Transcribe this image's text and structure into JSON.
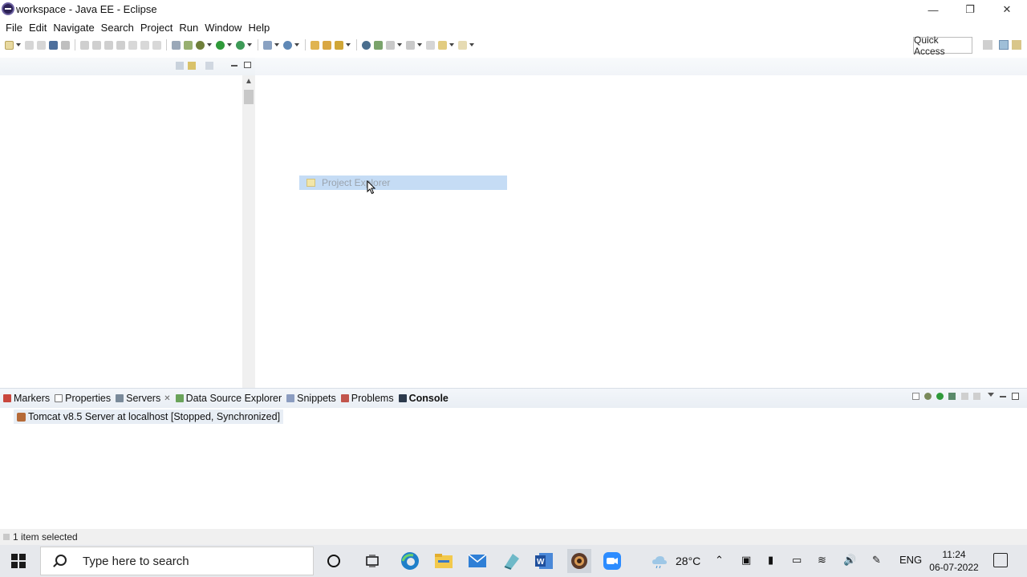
{
  "window": {
    "title": "workspace - Java EE - Eclipse"
  },
  "menu": [
    "File",
    "Edit",
    "Navigate",
    "Search",
    "Project",
    "Run",
    "Window",
    "Help"
  ],
  "toolbar": {
    "quick_access": "Quick Access"
  },
  "drag": {
    "label": "Project Explorer"
  },
  "bottom_tabs": [
    {
      "label": "Markers"
    },
    {
      "label": "Properties"
    },
    {
      "label": "Servers"
    },
    {
      "label": "Data Source Explorer"
    },
    {
      "label": "Snippets"
    },
    {
      "label": "Problems"
    },
    {
      "label": "Console"
    }
  ],
  "servers": [
    {
      "text": "Tomcat v8.5 Server at localhost  [Stopped, Synchronized]"
    }
  ],
  "status": {
    "text": "1 item selected"
  },
  "taskbar": {
    "search_placeholder": "Type here to search",
    "weather": "28°C",
    "language": "ENG",
    "time": "11:24",
    "date": "06-07-2022"
  },
  "colors": {
    "accent": "#c5dcf5",
    "header": "#eef2f6",
    "taskbar": "#e6e8ec"
  }
}
